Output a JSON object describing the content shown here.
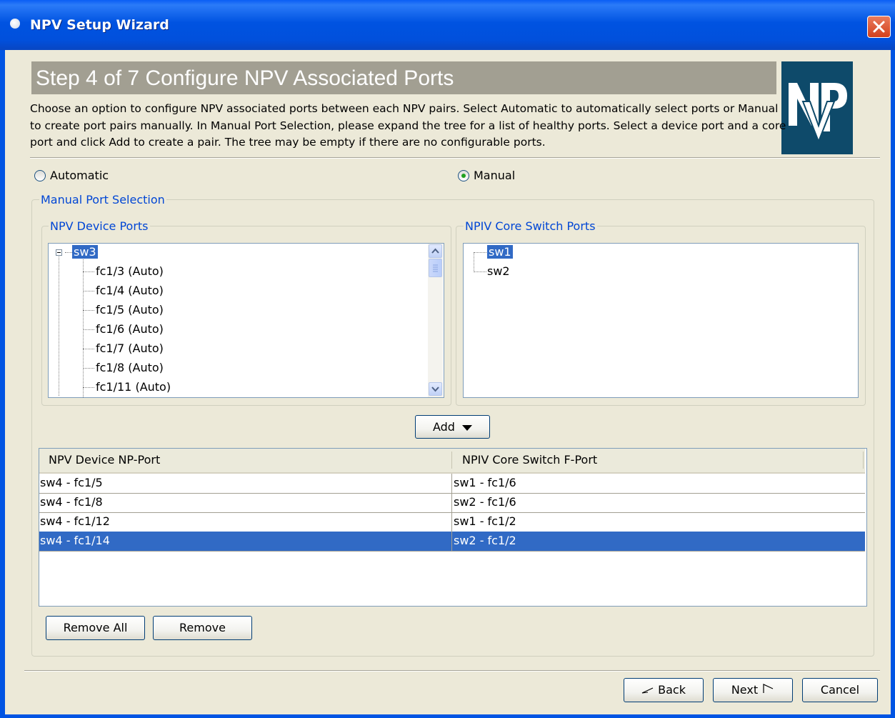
{
  "window": {
    "title": "NPV Setup Wizard"
  },
  "step": {
    "title": "Step 4 of 7 Configure NPV Associated Ports",
    "description": "Choose an option to configure NPV associated ports between each NPV pairs.  Select Automatic to automatically select ports or Manual to create port pairs manually.  In Manual Port Selection, please expand the tree for a list of healthy ports.  Select a device port and a core port and click Add to create a pair.  The tree may be empty if there are no configurable ports."
  },
  "logo": {
    "text": "NP",
    "color": "#0e4a6a"
  },
  "mode": {
    "automatic_label": "Automatic",
    "manual_label": "Manual",
    "selected": "Manual"
  },
  "manual_selection": {
    "label": "Manual Port Selection",
    "device_ports": {
      "label": "NPV Device Ports",
      "root": "sw3",
      "items": [
        "fc1/3 (Auto)",
        "fc1/4 (Auto)",
        "fc1/5 (Auto)",
        "fc1/6 (Auto)",
        "fc1/7 (Auto)",
        "fc1/8 (Auto)",
        "fc1/11 (Auto)"
      ]
    },
    "core_ports": {
      "label": "NPIV Core Switch Ports",
      "items": [
        "sw1",
        "sw2"
      ],
      "selected": "sw1"
    },
    "add_label": "Add"
  },
  "pairs_table": {
    "columns": [
      "NPV Device NP-Port",
      "NPIV Core Switch F-Port"
    ],
    "rows": [
      [
        "sw4 - fc1/5",
        "sw1 - fc1/6"
      ],
      [
        "sw4 - fc1/8",
        "sw2 - fc1/6"
      ],
      [
        "sw4 - fc1/12",
        "sw1 - fc1/2"
      ],
      [
        "sw4 - fc1/14",
        "sw2 - fc1/2"
      ]
    ],
    "selected_row": 3
  },
  "buttons": {
    "remove_all": "Remove All",
    "remove": "Remove",
    "back": "Back",
    "next": "Next",
    "cancel": "Cancel"
  },
  "colors": {
    "title_bar": "#0054e3",
    "selection": "#316ac5",
    "group_label": "#0046d5"
  }
}
